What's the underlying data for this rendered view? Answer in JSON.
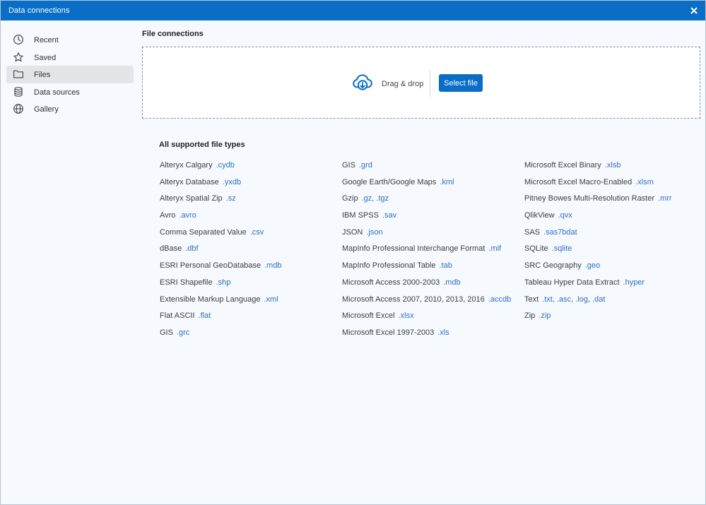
{
  "window": {
    "title": "Data connections",
    "accent": "#0a6ec6"
  },
  "sidebar": {
    "items": [
      {
        "label": "Recent",
        "icon": "clock-icon",
        "active": false
      },
      {
        "label": "Saved",
        "icon": "star-icon",
        "active": false
      },
      {
        "label": "Files",
        "icon": "folder-icon",
        "active": true
      },
      {
        "label": "Data sources",
        "icon": "database-icon",
        "active": false
      },
      {
        "label": "Gallery",
        "icon": "globe-icon",
        "active": false
      }
    ]
  },
  "main": {
    "section_title": "File connections",
    "dropzone": {
      "icon": "cloud-download-icon",
      "label": "Drag & drop",
      "button_label": "Select file"
    },
    "types_title": "All supported file types",
    "columns": [
      [
        {
          "name": "Alteryx Calgary",
          "ext": ".cydb"
        },
        {
          "name": "Alteryx Database",
          "ext": ".yxdb"
        },
        {
          "name": "Alteryx Spatial Zip",
          "ext": ".sz"
        },
        {
          "name": "Avro",
          "ext": ".avro"
        },
        {
          "name": "Comma Separated Value",
          "ext": ".csv"
        },
        {
          "name": "dBase",
          "ext": ".dbf"
        },
        {
          "name": "ESRI Personal GeoDatabase",
          "ext": ".mdb"
        },
        {
          "name": "ESRI Shapefile",
          "ext": ".shp"
        },
        {
          "name": "Extensible Markup Language",
          "ext": ".xml"
        },
        {
          "name": "Flat ASCII",
          "ext": ".flat"
        },
        {
          "name": "GIS",
          "ext": ".grc"
        }
      ],
      [
        {
          "name": "GIS",
          "ext": ".grd"
        },
        {
          "name": "Google Earth/Google Maps",
          "ext": ".kml"
        },
        {
          "name": "Gzip",
          "ext": ".gz, .tgz"
        },
        {
          "name": "IBM SPSS",
          "ext": ".sav"
        },
        {
          "name": "JSON",
          "ext": ".json"
        },
        {
          "name": "MapInfo Professional Interchange Format",
          "ext": ".mif"
        },
        {
          "name": "MapInfo Professional Table",
          "ext": ".tab"
        },
        {
          "name": "Microsoft Access 2000-2003",
          "ext": ".mdb"
        },
        {
          "name": "Microsoft Access 2007, 2010, 2013, 2016",
          "ext": ".accdb"
        },
        {
          "name": "Microsoft Excel",
          "ext": ".xlsx"
        },
        {
          "name": "Microsoft Excel 1997-2003",
          "ext": ".xls"
        }
      ],
      [
        {
          "name": "Microsoft Excel Binary",
          "ext": ".xlsb"
        },
        {
          "name": "Microsoft Excel Macro-Enabled",
          "ext": ".xlsm"
        },
        {
          "name": "Pitney Bowes Multi-Resolution Raster",
          "ext": ".mrr"
        },
        {
          "name": "QlikView",
          "ext": ".qvx"
        },
        {
          "name": "SAS",
          "ext": ".sas7bdat"
        },
        {
          "name": "SQLite",
          "ext": ".sqlite"
        },
        {
          "name": "SRC Geography",
          "ext": ".geo"
        },
        {
          "name": "Tableau Hyper Data Extract",
          "ext": ".hyper"
        },
        {
          "name": "Text",
          "ext": ".txt, .asc, .log, .dat"
        },
        {
          "name": "Zip",
          "ext": ".zip"
        }
      ]
    ]
  }
}
